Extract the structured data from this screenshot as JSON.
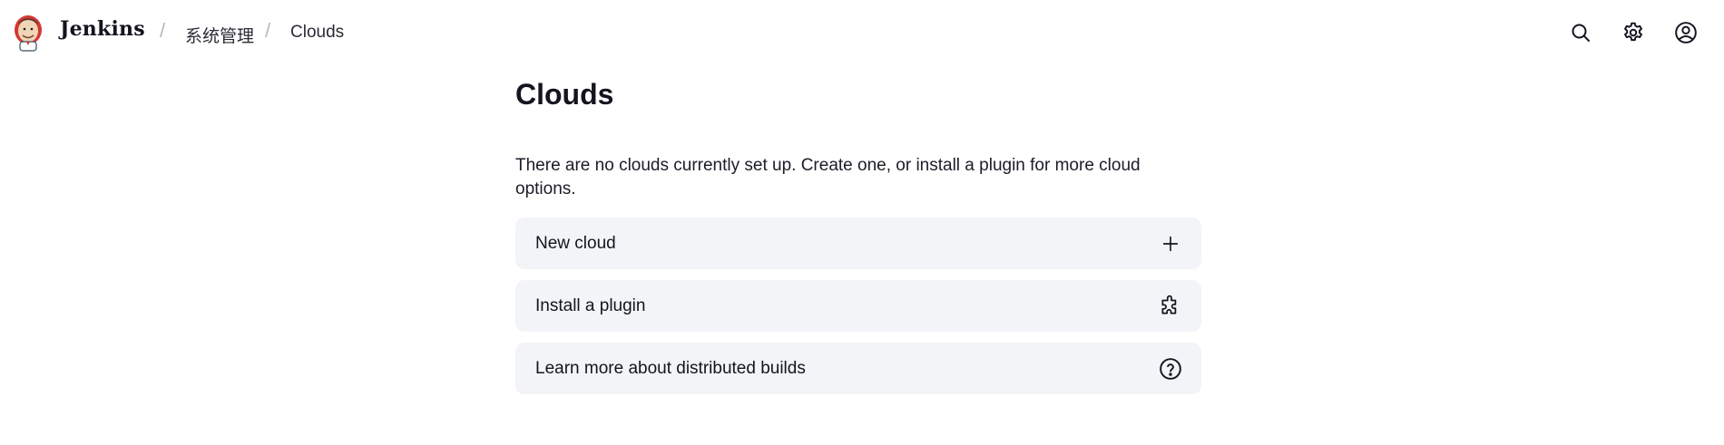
{
  "header": {
    "brand": "Jenkins",
    "breadcrumbs": [
      {
        "label": "系统管理"
      },
      {
        "label": "Clouds"
      }
    ],
    "separator": "/",
    "icons": [
      "search-icon",
      "gear-icon",
      "user-icon"
    ]
  },
  "main": {
    "title": "Clouds",
    "description": "There are no clouds currently set up. Create one, or install a plugin for more cloud options.",
    "actions": [
      {
        "label": "New cloud",
        "icon": "plus-icon"
      },
      {
        "label": "Install a plugin",
        "icon": "puzzle-icon"
      },
      {
        "label": "Learn more about distributed builds",
        "icon": "help-circle-icon"
      }
    ]
  },
  "colors": {
    "text": "#14141f",
    "action_bg": "#f2f4f7",
    "separator": "#b7b7c0"
  }
}
